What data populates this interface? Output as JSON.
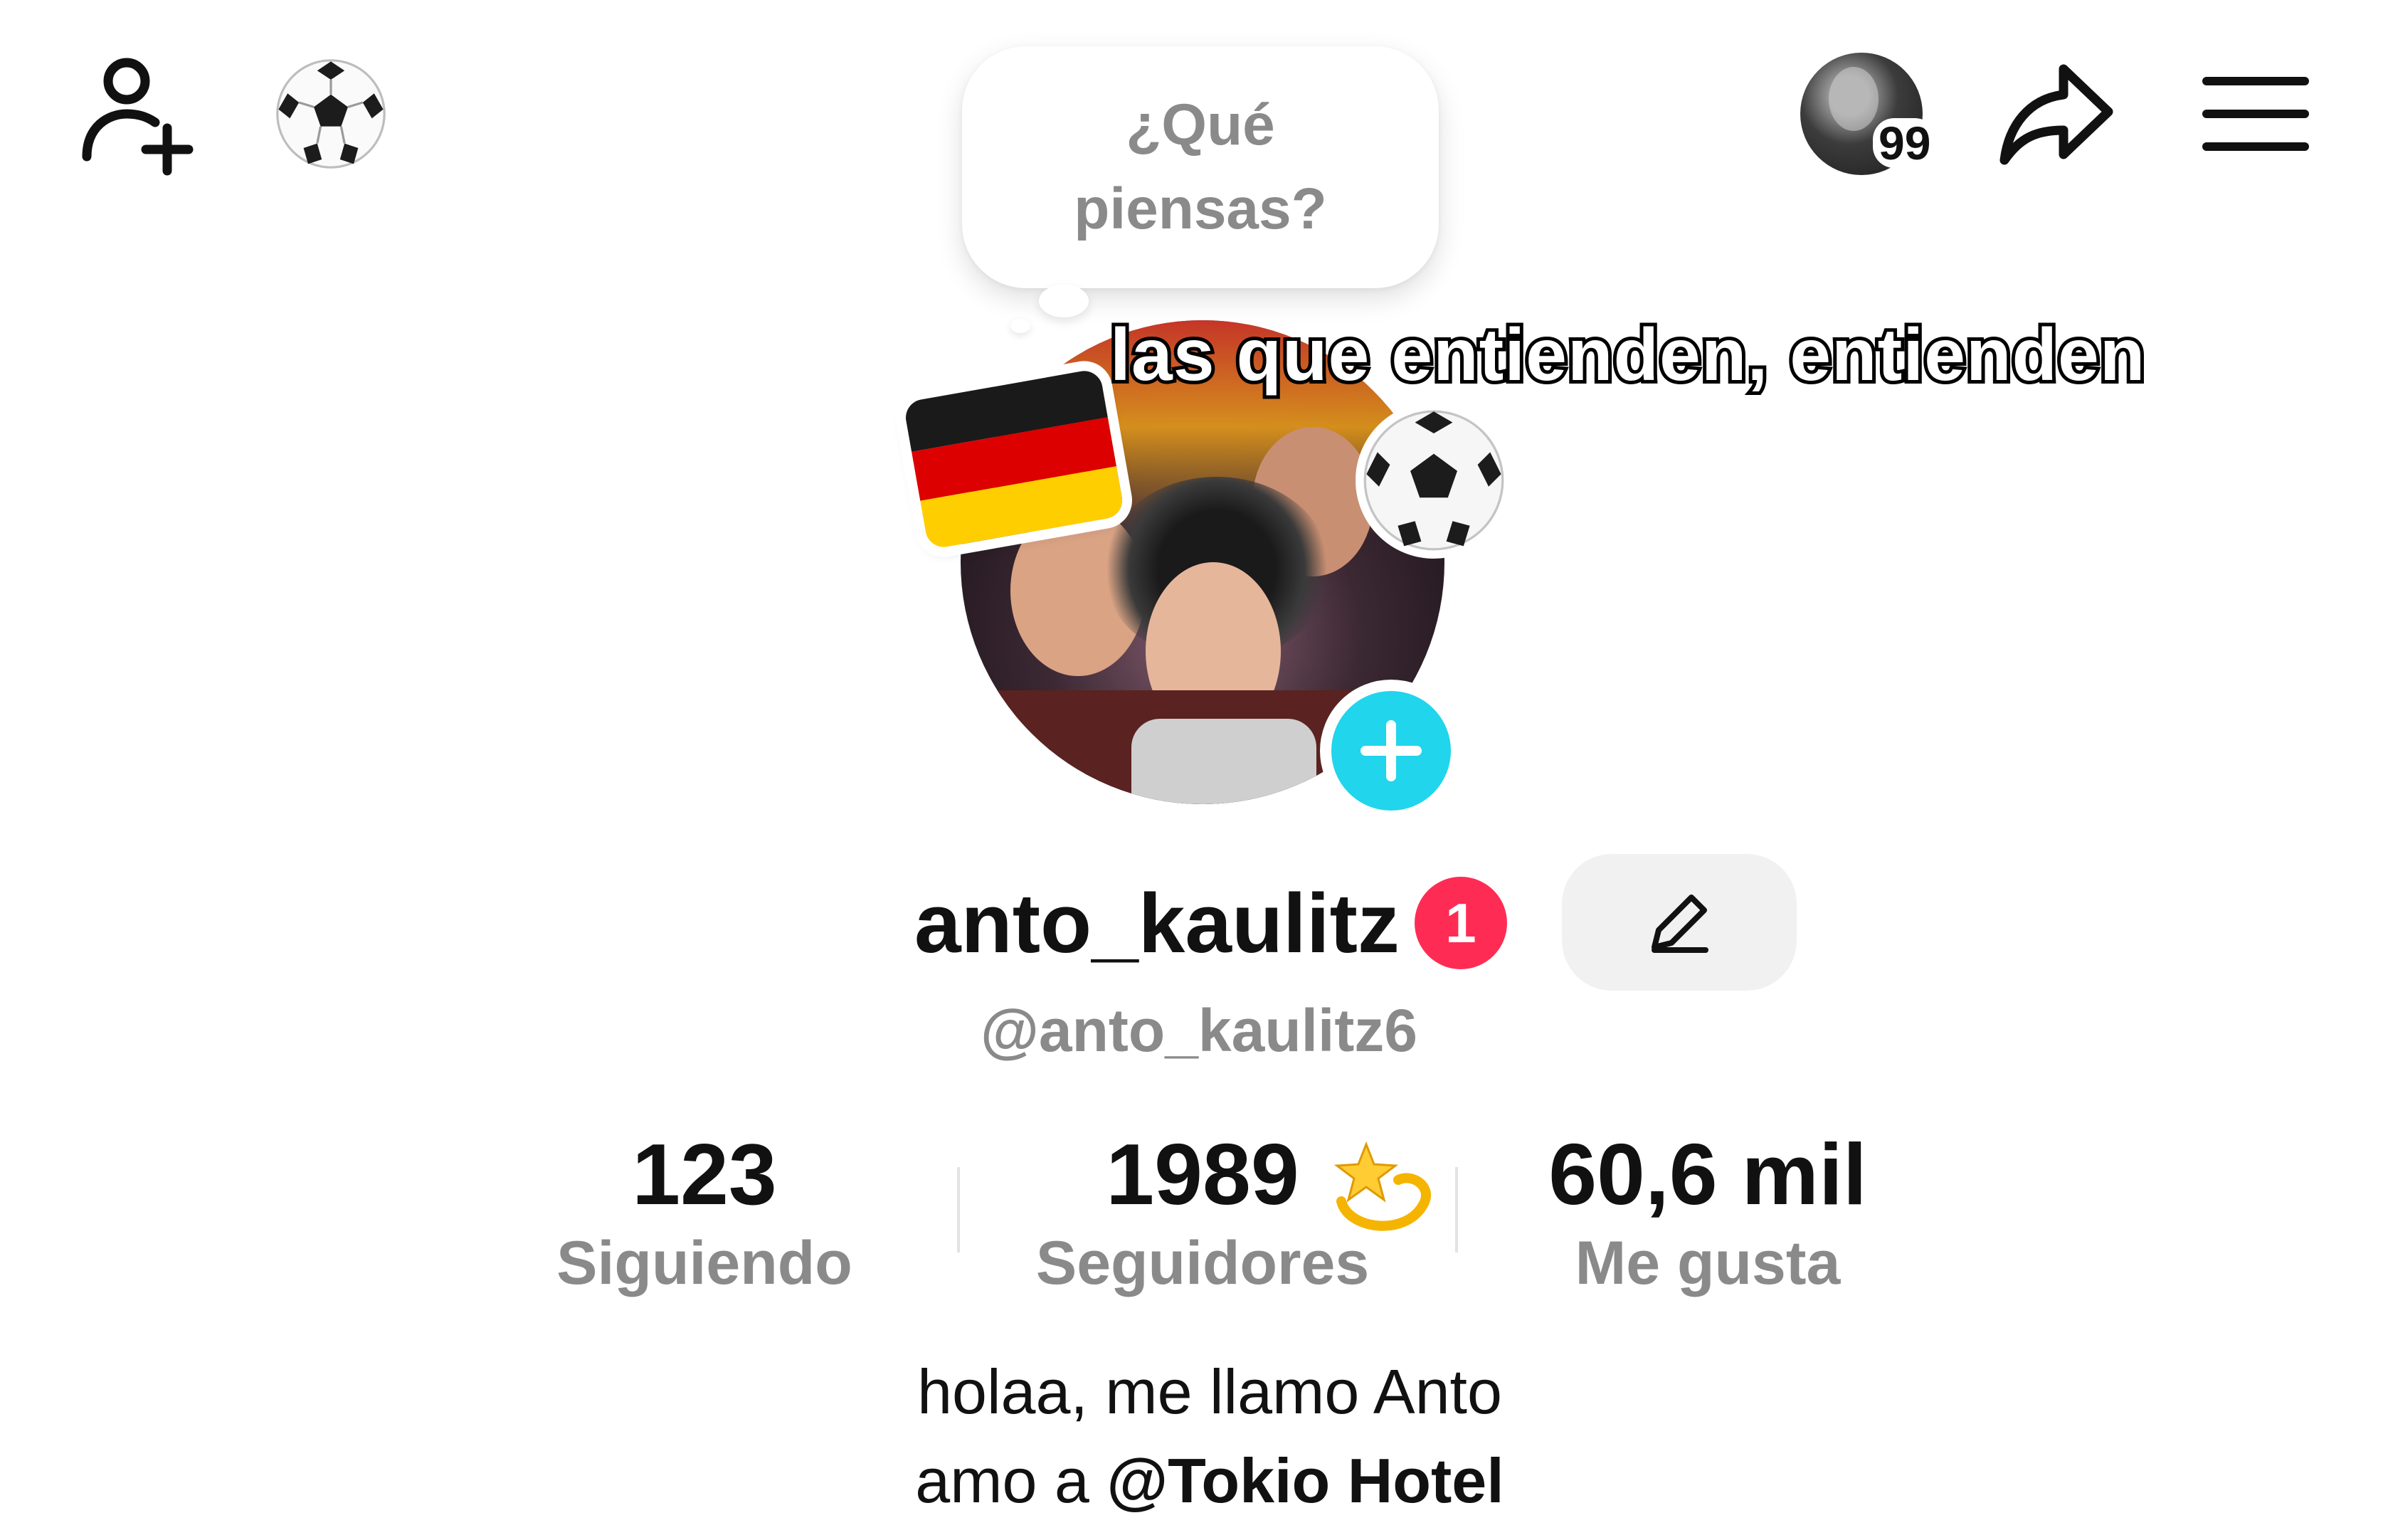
{
  "header": {
    "add_friend_icon": "add-person-icon",
    "emoji_icon": "soccer-ball",
    "story_count": "99",
    "share_icon": "share-arrow-icon",
    "menu_icon": "hamburger-menu-icon"
  },
  "thought_bubble": {
    "text": "¿Qué piensas?"
  },
  "profile_picture": {
    "overlay_text": "las que entienden, entienden",
    "stickers": [
      "german-flag",
      "soccer-ball"
    ]
  },
  "profile": {
    "username": "anto_kaulitz",
    "notification_count": "1",
    "handle": "@anto_kaulitz6"
  },
  "stats": {
    "following": {
      "value": "123",
      "label": "Siguiendo"
    },
    "followers": {
      "value": "1989",
      "label": "Seguidores"
    },
    "likes": {
      "value": "60,6 mil",
      "label": "Me gusta"
    }
  },
  "bio": {
    "line1": "holaa, me llamo Anto",
    "line2_prefix": "amo a ",
    "line2_mention": "@Tokio Hotel"
  },
  "colors": {
    "accent_cyan": "#20d5ec",
    "badge_red": "#fe2c55",
    "secondary_text": "#8a8a8a"
  }
}
